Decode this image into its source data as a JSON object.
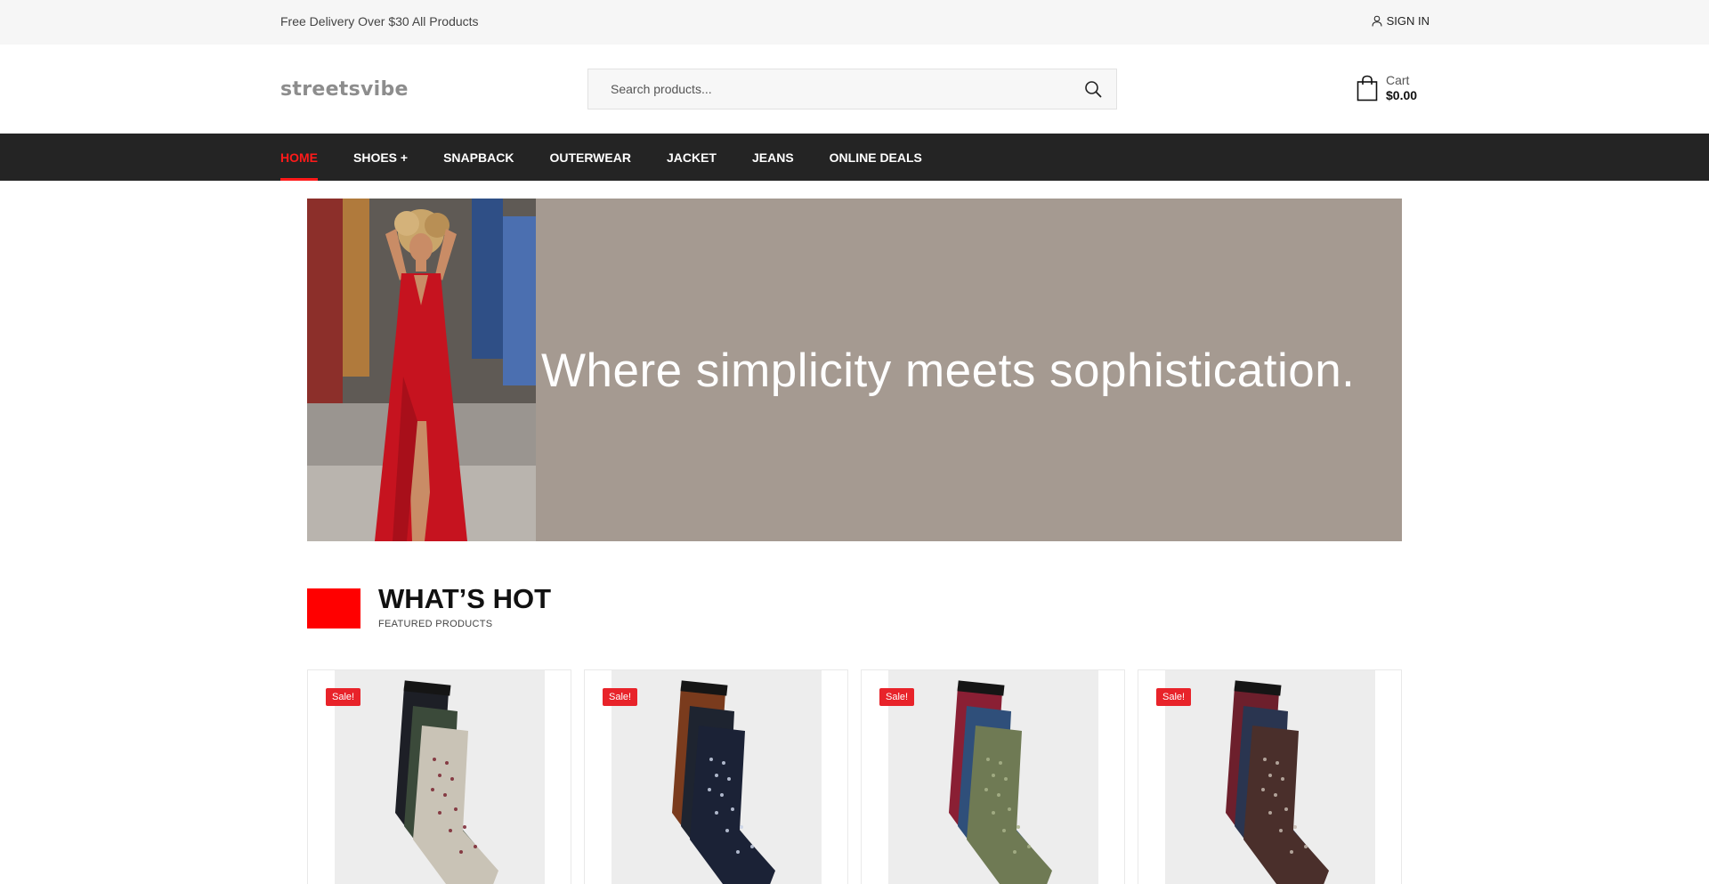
{
  "topbar": {
    "promo": "Free Delivery Over $30 All Products",
    "signin": "SIGN IN"
  },
  "header": {
    "logo": "streetsvibe",
    "search_placeholder": "Search products...",
    "cart_label": "Cart",
    "cart_total": "$0.00"
  },
  "nav": {
    "items": [
      {
        "label": "HOME",
        "active": true
      },
      {
        "label": "SHOES +",
        "active": false
      },
      {
        "label": "SNAPBACK",
        "active": false
      },
      {
        "label": "OUTERWEAR",
        "active": false
      },
      {
        "label": "JACKET",
        "active": false
      },
      {
        "label": "JEANS",
        "active": false
      },
      {
        "label": "ONLINE DEALS",
        "active": false
      }
    ]
  },
  "hero": {
    "headline": "Where simplicity meets sophistication."
  },
  "section": {
    "title": "WHAT’S HOT",
    "subtitle": "FEATURED PRODUCTS"
  },
  "products": [
    {
      "badge": "Sale!",
      "sock_colors": [
        "#1d1f26",
        "#3b4a3a",
        "#c9c3b6"
      ],
      "pattern": "#7a2430"
    },
    {
      "badge": "Sale!",
      "sock_colors": [
        "#7a3b1d",
        "#1e2430",
        "#1b2236"
      ],
      "pattern": "#c9d2e6"
    },
    {
      "badge": "Sale!",
      "sock_colors": [
        "#8a1f34",
        "#2f4f7a",
        "#6f7a54"
      ],
      "pattern": "#a9b38a"
    },
    {
      "badge": "Sale!",
      "sock_colors": [
        "#6d1f2c",
        "#2a3550",
        "#4a2f2b"
      ],
      "pattern": "#c4b7ad"
    }
  ],
  "colors": {
    "accent": "#ff1a1a",
    "nav_bg": "#242424",
    "hero_bg": "#a59a91",
    "badge": "#e8232a"
  },
  "icons": {
    "signin": "user-icon",
    "search": "search-icon",
    "cart": "shopping-bag-icon"
  }
}
